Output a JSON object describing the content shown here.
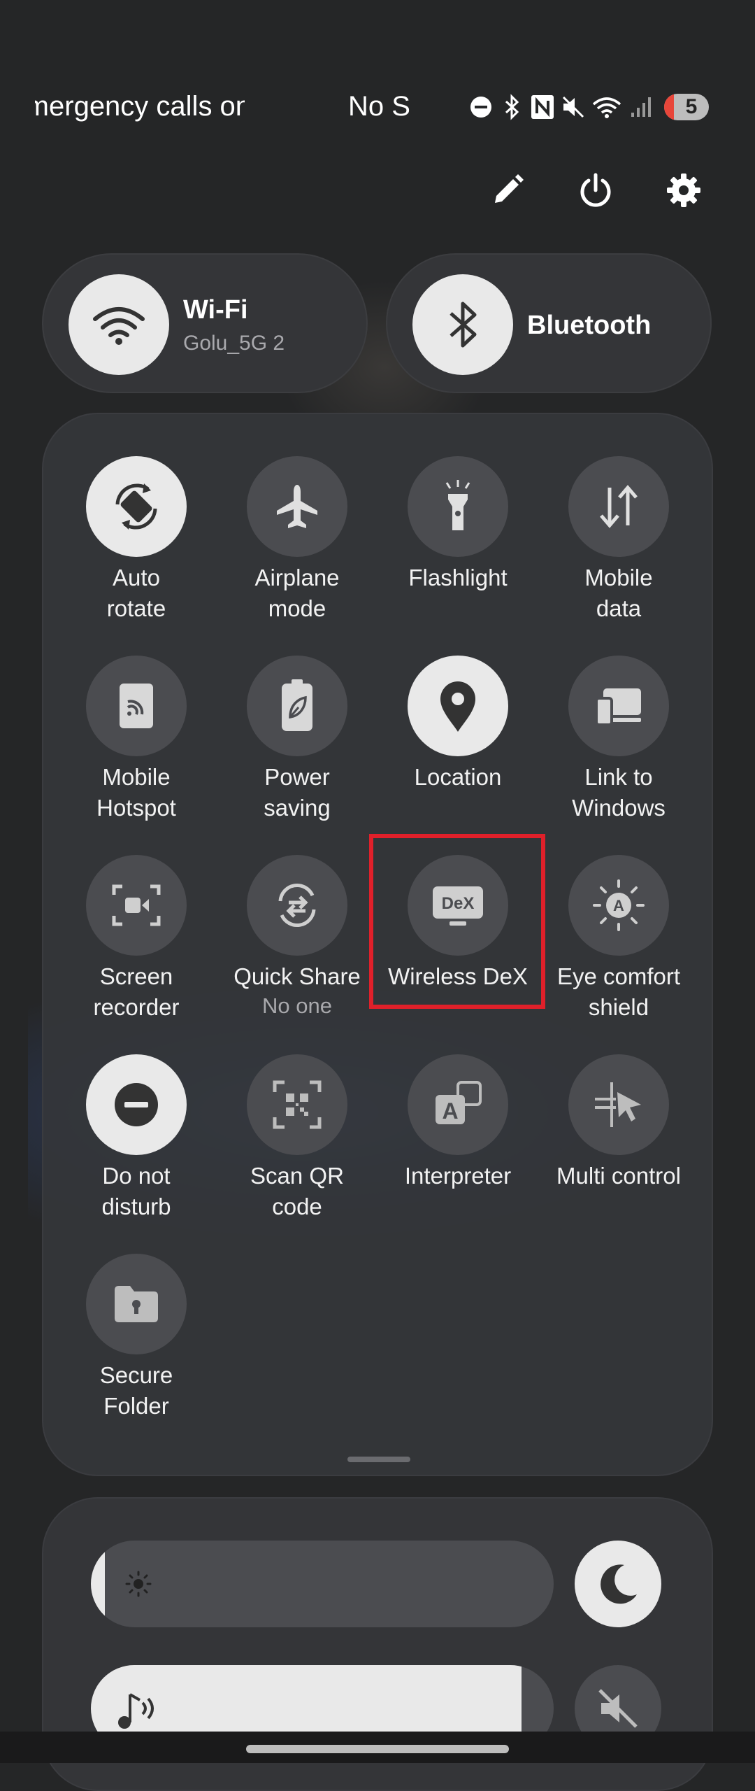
{
  "status_bar": {
    "carrier_text": "Emergency calls only",
    "sim_text": "No SIM",
    "battery_level": "5",
    "icons": [
      "do-not-disturb-icon",
      "bluetooth-icon",
      "nfc-icon",
      "mute-icon",
      "wifi-icon",
      "signal-icon"
    ]
  },
  "top_actions": [
    "edit-icon",
    "power-icon",
    "settings-icon"
  ],
  "wifi": {
    "label": "Wi-Fi",
    "network": "Golu_5G 2",
    "on": true
  },
  "bluetooth": {
    "label": "Bluetooth",
    "on": true
  },
  "tiles": [
    {
      "label": "Auto rotate",
      "line1": "Auto",
      "line2": "rotate",
      "on": true,
      "icon": "auto-rotate-icon"
    },
    {
      "label": "Airplane mode",
      "line1": "Airplane",
      "line2": "mode",
      "on": false,
      "icon": "airplane-icon"
    },
    {
      "label": "Flashlight",
      "line1": "Flashlight",
      "line2": "",
      "on": false,
      "icon": "flashlight-icon"
    },
    {
      "label": "Mobile data",
      "line1": "Mobile",
      "line2": "data",
      "on": false,
      "icon": "mobile-data-icon"
    },
    {
      "label": "Mobile Hotspot",
      "line1": "Mobile",
      "line2": "Hotspot",
      "on": false,
      "icon": "hotspot-icon"
    },
    {
      "label": "Power saving",
      "line1": "Power",
      "line2": "saving",
      "on": false,
      "icon": "power-saving-icon"
    },
    {
      "label": "Location",
      "line1": "Location",
      "line2": "",
      "on": true,
      "icon": "location-icon"
    },
    {
      "label": "Link to Windows",
      "line1": "Link to",
      "line2": "Windows",
      "on": false,
      "icon": "link-to-windows-icon"
    },
    {
      "label": "Screen recorder",
      "line1": "Screen",
      "line2": "recorder",
      "on": false,
      "icon": "screen-recorder-icon"
    },
    {
      "label": "Quick Share",
      "line1": "Quick Share",
      "line2": "",
      "sub": "No one",
      "on": false,
      "icon": "quick-share-icon"
    },
    {
      "label": "Wireless DeX",
      "line1": "Wireless DeX",
      "line2": "",
      "on": false,
      "icon": "dex-icon"
    },
    {
      "label": "Eye comfort shield",
      "line1": "Eye comfort",
      "line2": "shield",
      "on": false,
      "icon": "eye-comfort-icon"
    },
    {
      "label": "Do not disturb",
      "line1": "Do not",
      "line2": "disturb",
      "on": true,
      "icon": "do-not-disturb-icon"
    },
    {
      "label": "Scan QR code",
      "line1": "Scan QR",
      "line2": "code",
      "on": false,
      "icon": "qr-code-icon"
    },
    {
      "label": "Interpreter",
      "line1": "Interpreter",
      "line2": "",
      "on": false,
      "icon": "interpreter-icon"
    },
    {
      "label": "Multi control",
      "line1": "Multi control",
      "line2": "",
      "on": false,
      "icon": "multi-control-icon"
    },
    {
      "label": "Secure Folder",
      "line1": "Secure",
      "line2": "Folder",
      "on": false,
      "icon": "secure-folder-icon"
    }
  ],
  "dex_badge": "DeX",
  "brightness": {
    "level": 0.03
  },
  "media_volume": {
    "level": 0.93
  },
  "colors": {
    "background": "#252627",
    "tile_off": "#4b4c50",
    "tile_on": "#e9e9e9",
    "highlight": "#e0202a"
  }
}
